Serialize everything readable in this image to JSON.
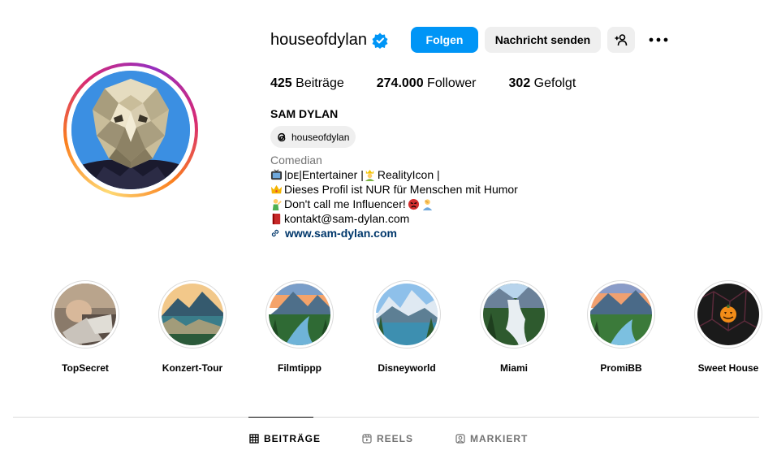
{
  "profile": {
    "username": "houseofdylan",
    "follow_label": "Folgen",
    "message_label": "Nachricht senden",
    "stats": {
      "posts_count": "425",
      "posts_label": "Beiträge",
      "followers_count": "274.000",
      "followers_label": "Follower",
      "following_count": "302",
      "following_label": "Gefolgt"
    },
    "full_name": "SAM DYLAN",
    "threads_handle": "houseofdylan",
    "category": "Comedian",
    "bio": {
      "line1": "|ᴅᴇ|Entertainer | ",
      "line1b": "RealityIcon |",
      "line2": "Dieses Profil ist NUR für Menschen mit Humor",
      "line3": "Don't call me Influencer!",
      "line4": "kontakt@sam-dylan.com"
    },
    "website": "www.sam-dylan.com"
  },
  "highlights": [
    {
      "label": "TopSecret"
    },
    {
      "label": "Konzert-Tour"
    },
    {
      "label": "Filmtippp"
    },
    {
      "label": "Disneyworld"
    },
    {
      "label": "Miami"
    },
    {
      "label": "PromiBB"
    },
    {
      "label": "Sweet House"
    }
  ],
  "tabs": {
    "posts": "BEITRÄGE",
    "reels": "REELS",
    "tagged": "MARKIERT"
  },
  "colors": {
    "accent": "#0095f6",
    "button_secondary": "#efefef",
    "link": "#00376b",
    "muted": "#737373"
  },
  "icons": [
    "verified-badge-icon",
    "add-user-icon",
    "more-options-icon",
    "threads-icon",
    "link-icon",
    "grid-icon",
    "reels-icon",
    "tagged-icon"
  ]
}
